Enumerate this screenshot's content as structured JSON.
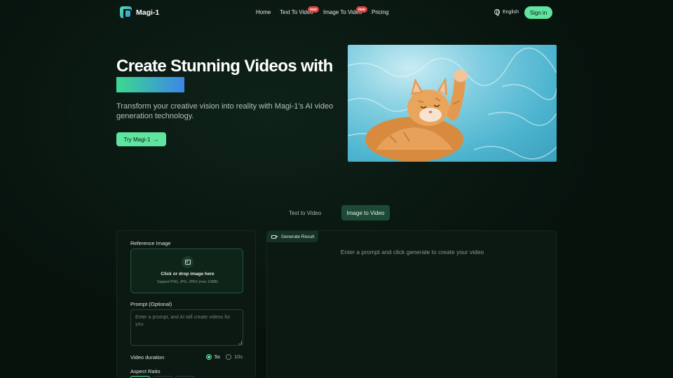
{
  "nav": {
    "brand": "Magi-1",
    "links": [
      {
        "label": "Home"
      },
      {
        "label": "Text To Video",
        "badge": "new"
      },
      {
        "label": "Image To Video",
        "badge": "new"
      },
      {
        "label": "Pricing"
      }
    ],
    "language": "English",
    "signin": "Sign in"
  },
  "hero": {
    "title": "Create Stunning Videos with",
    "subtitle": "Transform your creative vision into reality with Magi-1's AI video generation technology.",
    "cta": "Try Magi-1",
    "cta_icon": "arrow-right-icon",
    "image_subject": "orange tabby cat floating on water"
  },
  "tabs": [
    {
      "label": "Text to Video",
      "active": false
    },
    {
      "label": "Image to Video",
      "active": true
    }
  ],
  "form": {
    "reference_label": "Reference Image",
    "drop_title": "Click or drop image here",
    "drop_sub": "Support PNG, JPG, JPEG (max 10MB)",
    "prompt_label": "Prompt (Optional)",
    "prompt_placeholder": "Enter a prompt, and AI will create videos for you.",
    "duration_label": "Video duration",
    "duration_options": [
      {
        "label": "5s",
        "selected": true
      },
      {
        "label": "10s",
        "selected": false
      }
    ],
    "aspect_label": "Aspect Ratio"
  },
  "result": {
    "tab_label": "Generate Result",
    "empty_text": "Enter a prompt and click generate to create your video"
  },
  "colors": {
    "background": "#07120d",
    "accent": "#5fe59f",
    "badge": "#e0433f"
  }
}
